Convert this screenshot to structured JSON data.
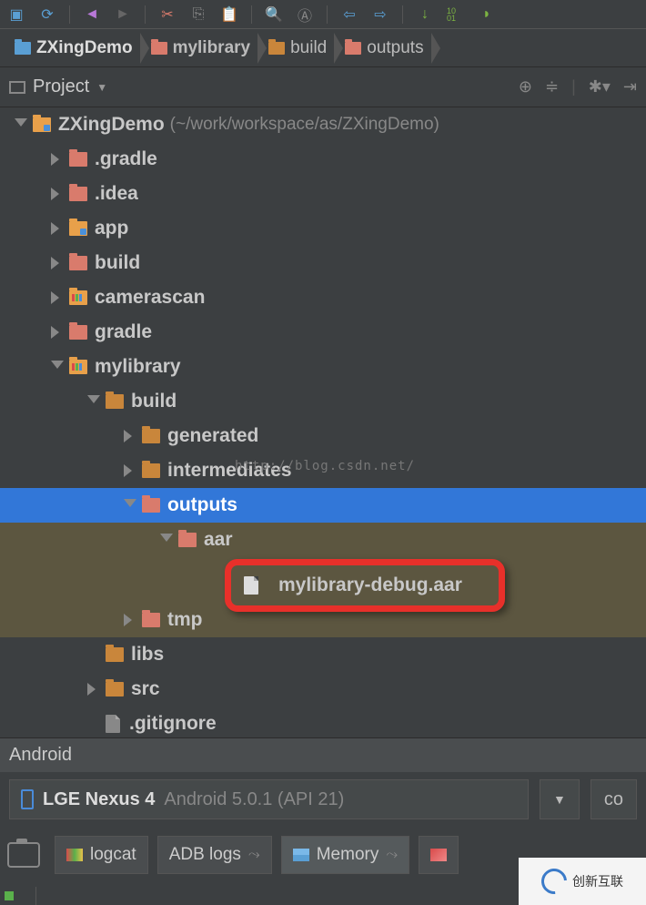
{
  "toolbar_numbers": "10\n01",
  "breadcrumb": [
    {
      "label": "ZXingDemo",
      "icon": "module"
    },
    {
      "label": "mylibrary",
      "icon": "salmon"
    },
    {
      "label": "build",
      "icon": "orange"
    },
    {
      "label": "outputs",
      "icon": "salmon"
    }
  ],
  "project_panel": {
    "title": "Project"
  },
  "watermark": "http://blog.csdn.net/",
  "tree": {
    "root": {
      "name": "ZXingDemo",
      "path": "(~/work/workspace/as/ZXingDemo)"
    },
    "items": [
      {
        "name": ".gradle",
        "icon": "salmon",
        "depth": 1,
        "arrow": "closed"
      },
      {
        "name": ".idea",
        "icon": "salmon",
        "depth": 1,
        "arrow": "closed"
      },
      {
        "name": "app",
        "icon": "module",
        "depth": 1,
        "arrow": "closed"
      },
      {
        "name": "build",
        "icon": "salmon",
        "depth": 1,
        "arrow": "closed"
      },
      {
        "name": "camerascan",
        "icon": "lib",
        "depth": 1,
        "arrow": "closed"
      },
      {
        "name": "gradle",
        "icon": "salmon",
        "depth": 1,
        "arrow": "closed"
      },
      {
        "name": "mylibrary",
        "icon": "lib",
        "depth": 1,
        "arrow": "open"
      },
      {
        "name": "build",
        "icon": "orange",
        "depth": 2,
        "arrow": "open"
      },
      {
        "name": "generated",
        "icon": "orange",
        "depth": 3,
        "arrow": "closed"
      },
      {
        "name": "intermediates",
        "icon": "orange",
        "depth": 3,
        "arrow": "closed"
      },
      {
        "name": "outputs",
        "icon": "salmon",
        "depth": 3,
        "arrow": "open",
        "sel": true
      },
      {
        "name": "aar",
        "icon": "salmon",
        "depth": 4,
        "arrow": "open",
        "hi": true
      },
      {
        "name": "mylibrary-debug.aar",
        "icon": "file",
        "depth": 5,
        "arrow": "none",
        "hi": true,
        "boxed": true
      },
      {
        "name": "tmp",
        "icon": "salmon",
        "depth": 3,
        "arrow": "closed",
        "hi": true
      },
      {
        "name": "libs",
        "icon": "orange",
        "depth": 2,
        "arrow": "none"
      },
      {
        "name": "src",
        "icon": "orange",
        "depth": 2,
        "arrow": "closed"
      },
      {
        "name": ".gitignore",
        "icon": "file-txt",
        "depth": 2,
        "arrow": "none"
      }
    ]
  },
  "android_bar": "Android",
  "device": {
    "name": "LGE Nexus 4",
    "os": "Android 5.0.1 (API 21)"
  },
  "co_btn": "co",
  "tabs": [
    {
      "label": "logcat",
      "icon": "android"
    },
    {
      "label": "ADB logs",
      "icon": "none",
      "pin": true
    },
    {
      "label": "Memory",
      "icon": "chart",
      "active": true,
      "pin": true
    },
    {
      "label": "",
      "icon": "chart-red"
    }
  ],
  "logo": "创新互联"
}
